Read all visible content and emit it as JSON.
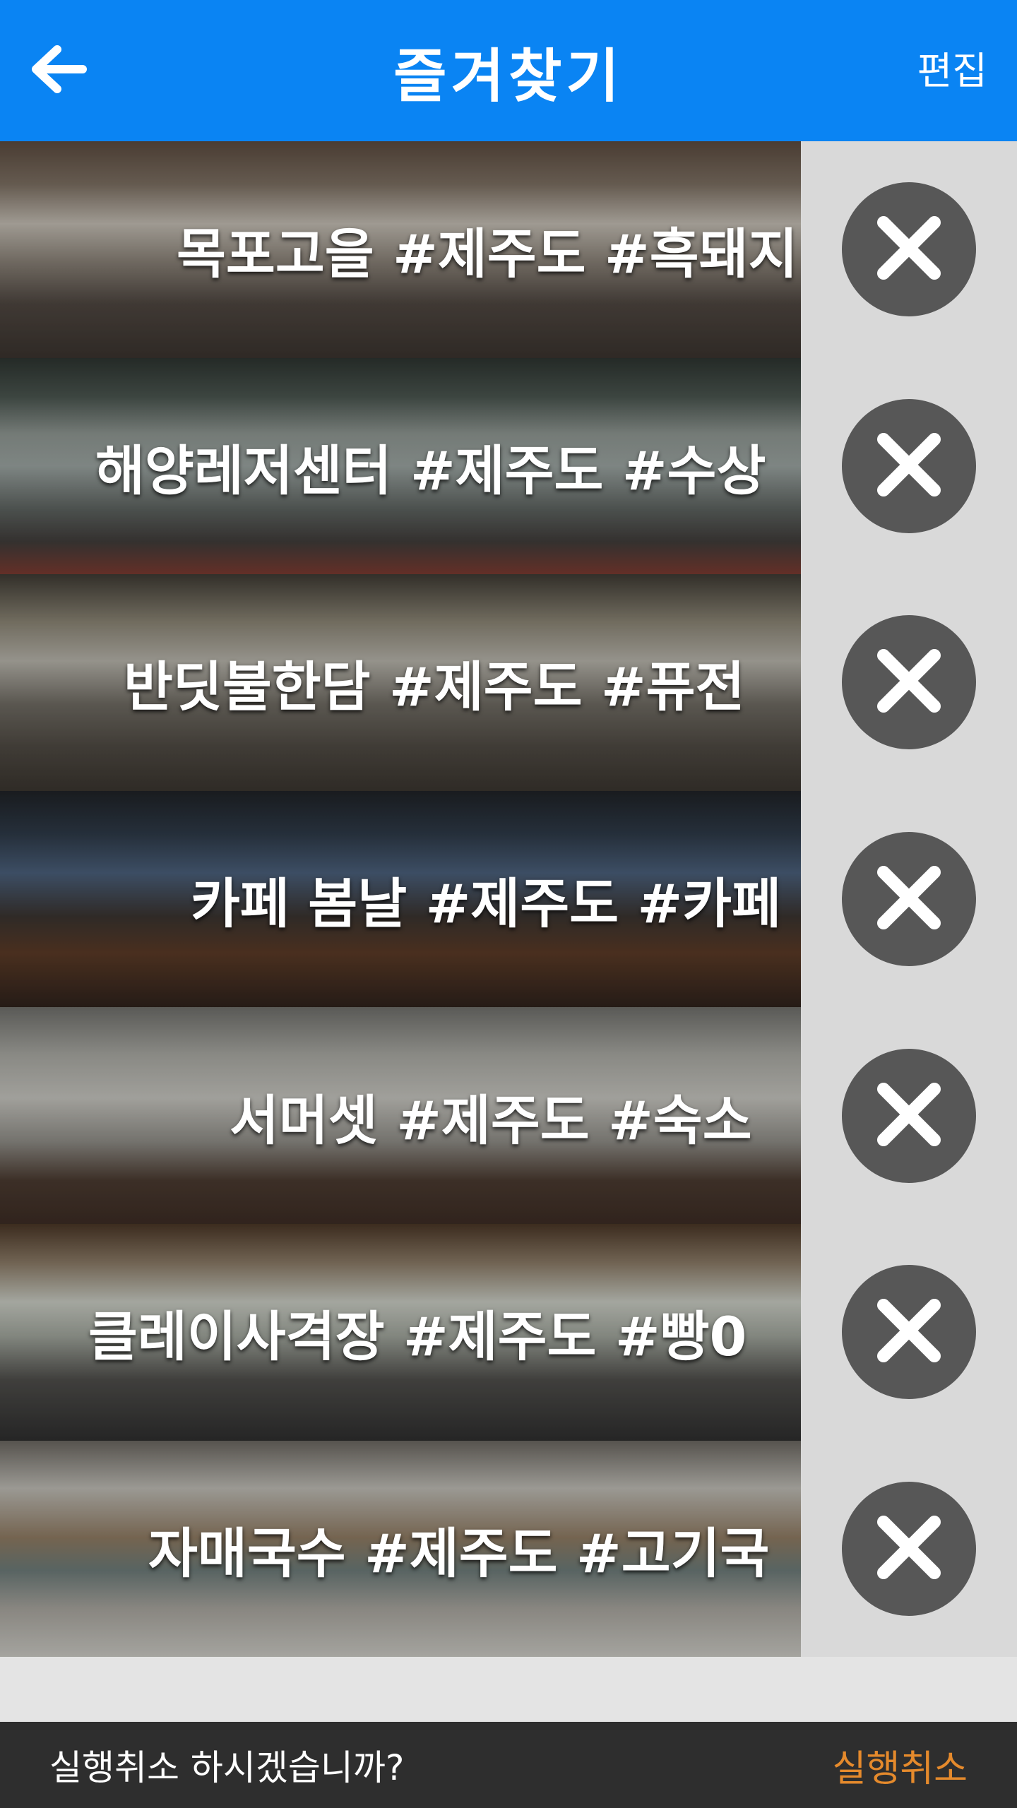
{
  "header": {
    "back_icon": "arrow-left-icon",
    "title": "즐겨찾기",
    "edit_label": "편집",
    "background_color": "#0a84f3"
  },
  "favorites": [
    {
      "label": "목포고을 #제주도 #흑돼지",
      "delete_icon": "close-icon"
    },
    {
      "label": "해양레저센터 #제주도 #수상",
      "delete_icon": "close-icon"
    },
    {
      "label": "반딧불한담 #제주도 #퓨전",
      "delete_icon": "close-icon"
    },
    {
      "label": "카페 봄날 #제주도 #카페",
      "delete_icon": "close-icon"
    },
    {
      "label": "서머셋 #제주도 #숙소",
      "delete_icon": "close-icon"
    },
    {
      "label": "클레이사격장 #제주도 #빵0",
      "delete_icon": "close-icon"
    },
    {
      "label": "자매국수 #제주도 #고기국",
      "delete_icon": "close-icon"
    }
  ],
  "snackbar": {
    "message": "실행취소 하시겠습니까?",
    "action_label": "실행취소",
    "action_color": "#e58a2c"
  }
}
